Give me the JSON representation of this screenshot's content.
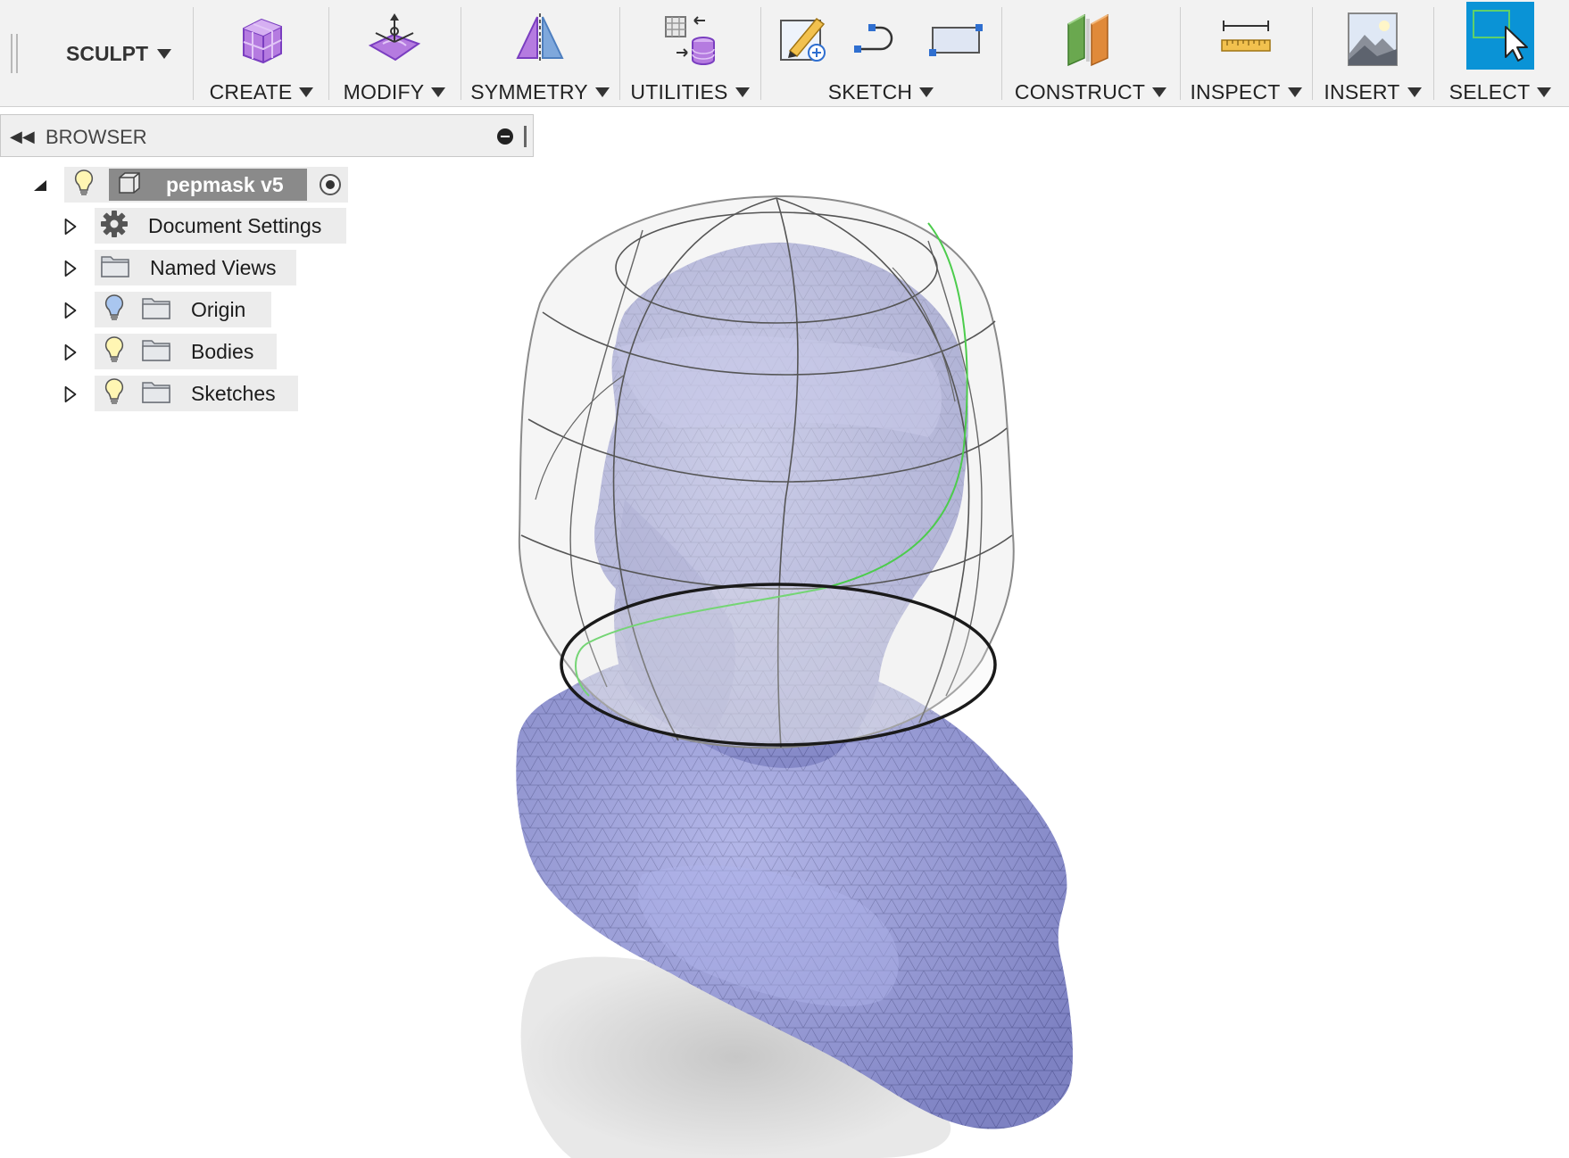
{
  "toolbar": {
    "workspace": "SCULPT",
    "groups": [
      {
        "label": "CREATE"
      },
      {
        "label": "MODIFY"
      },
      {
        "label": "SYMMETRY"
      },
      {
        "label": "UTILITIES"
      },
      {
        "label": "SKETCH"
      },
      {
        "label": "CONSTRUCT"
      },
      {
        "label": "INSPECT"
      },
      {
        "label": "INSERT"
      },
      {
        "label": "SELECT"
      }
    ]
  },
  "browser": {
    "title": "BROWSER",
    "root": {
      "label": "pepmask v5"
    },
    "items": [
      {
        "label": "Document Settings",
        "icon": "gear-icon"
      },
      {
        "label": "Named Views",
        "icon": "folder-icon"
      },
      {
        "label": "Origin",
        "icon": "folder-icon",
        "bulb": "blue"
      },
      {
        "label": "Bodies",
        "icon": "folder-icon",
        "bulb": "yellow"
      },
      {
        "label": "Sketches",
        "icon": "folder-icon",
        "bulb": "yellow"
      }
    ]
  },
  "colors": {
    "mesh_fill": "#9a9ee0",
    "mesh_line": "#5a5e9a",
    "cage_fill": "#e6e6e6",
    "accent": "#0a93d6",
    "green_edge": "#4ccc4c"
  }
}
